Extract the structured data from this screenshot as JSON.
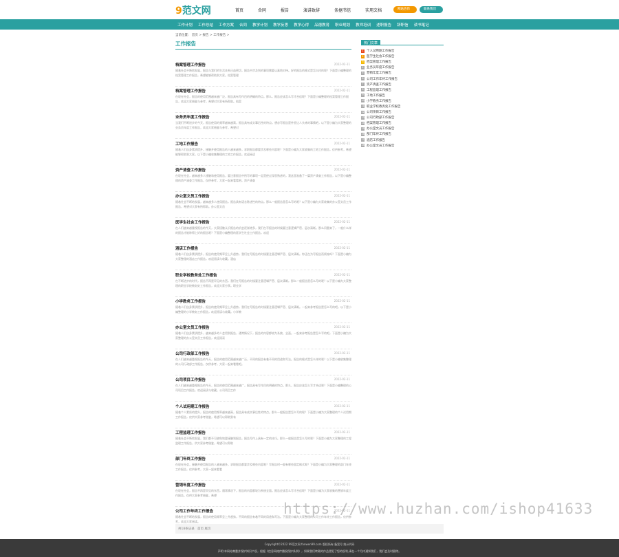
{
  "logo": {
    "nine": "9",
    "text": "范文网"
  },
  "topnav": [
    "首页",
    "合同",
    "报告",
    "演讲致辞",
    "条据书信",
    "实用文档"
  ],
  "header_buttons": {
    "login": "网站合作",
    "login2": "联系我们"
  },
  "categories": [
    "工作计划",
    "工作总结",
    "工作方案",
    "合同",
    "教学计划",
    "教学反思",
    "教学心得",
    "品德教育",
    "职业规划",
    "教师培训",
    "述职报告",
    "辞职信",
    "读书笔记"
  ],
  "breadcrumb": "当前位置： 首页 > 报告 > 工作报告 >",
  "main_title": "工作报告",
  "articles": [
    {
      "title": "档案管理工作报告",
      "date": "2022-02-11",
      "summary": "随着社会不断地发展，报告与我们的生活关系日益密切，报告中涉及到的事项需要认真地对待。好的报告的格式是怎么样的呢？下面是小编整理的档案管理工作报告，希望能够帮助到大家。档案管理"
    },
    {
      "title": "档案管理工作报告",
      "date": "2022-02-11",
      "summary": "在现在社会，报告的使用范围越来越广泛，报告具有写作目的明确的特点。那么，报告应该怎么写才合适呢？下面是小编整理的档案管理工作报告，欢迎大家借鉴与参考，希望对大家有所帮助。档案"
    },
    {
      "title": "业务员年度工作报告",
      "date": "2022-02-11",
      "summary": "当我们不断进步的今天，报告使用的频率越来越高，报告具有成文事后性的特点。想必写报告是件很让人头疼的事情吧，以下是小编为大家整理的业务员年度工作报告，欢迎大家借鉴与参考，希望对"
    },
    {
      "title": "工地工作报告",
      "date": "2022-02-11",
      "summary": "随着人们自身素质提升，接触并使用报告的人越来越多，求职报告都要涉及哪些内容呢？下面是小编为大家收集的工地工作报告，仅供参考，希望能够帮助到大家。以下是小编收集整理的工地工作报告，欢迎阅读"
    },
    {
      "title": "资产清查工作报告",
      "date": "2022-02-11",
      "summary": "在现在社会，越来越多人接触和使用报告，要注意报告中所写的事项一定是经过深思熟虑的，我这里准备了一篇资产清查工作报告，以下是小编整理的资产清查工作报告，仅供参考，大家一起来看看吧。资产清查"
    },
    {
      "title": "办公室文员工作报告",
      "date": "2022-02-11",
      "summary": "随着社会不断地发展，越来越多人使用报告，报告具有语言陈述性的特点。那么一般报告是怎么写的呢？以下是小编为大家收集的办公室文员工作报告，希望对大家有所帮助。办公室文员"
    },
    {
      "title": "医学生社会工作报告",
      "date": "2022-02-11",
      "summary": "在人们越来越重视报告的今天，大家接触认识报告的机会逐渐增多，我们在写报告的时候要注意逻辑严密、层次清晰。那么问题来了，一般什么样的报告才能称得上好的报告呢？下面是小编整理的医学生社会工作报告，欢迎"
    },
    {
      "title": "酒店工作报告",
      "date": "2022-02-11",
      "summary": "随着人们自身素质提升，报告的使用频率呈上升趋势，我们在写报告的时候要注意逻辑严密、层次清晰。你还在为写报告而烦恼吗？下面是小编为大家整理的酒店工作报告，欢迎阅读与收藏。酒店"
    },
    {
      "title": "职业学校教务处工作报告",
      "date": "2022-02-11",
      "summary": "在不断进步的时代，报告不再是罕见的东西，我们在写报告的时候要注意逻辑严密、层次清晰。那么一般报告是怎么写的呢？以下是小编为大家整理的职业学校教务处工作报告，欢迎大家分享。职业学"
    },
    {
      "title": "小学教务工作报告",
      "date": "2022-02-11",
      "summary": "随着人们自身素质提升，报告的使用频率呈上升趋势，我们在写报告的时候要注意逻辑严密、层次清晰。一起来参考报告是怎么写的吧，以下是小编整理的小学教务工作报告，欢迎阅读与收藏。小学教"
    },
    {
      "title": "办公室文员工作报告",
      "date": "2022-02-11",
      "summary": "随着人们自身素质提升，越来越多的人会用到报告，通常情况下，报告的内容都较为系统、全面。一起来参考报告是怎么写的吧，下面是小编为大家整理的办公室文员工作报告，欢迎阅读"
    },
    {
      "title": "公司行政部工作报告",
      "date": "2022-02-11",
      "summary": "在人们越来越重视报告的今天，报告的使用范围越来越广泛，不同的报告有着不同的用途和写法。报告的格式是怎么样的呢？以下是小编收集整理的公司行政部工作报告，仅供参考，大家一起来看看吧。"
    },
    {
      "title": "公司项目工作报告",
      "date": "2022-02-11",
      "summary": "在人们越来越重视报告的今天，报告的使用范围越来越广，报告具有写作目的明确的特点。那么，报告应该怎么写才合适呢？下面是小编整理的公司项目工作报告，欢迎阅读与收藏。公司项目工作"
    },
    {
      "title": "个人试用期工作报告",
      "date": "2022-02-11",
      "summary": "随着个人素质的提升，报告的使用频率越来越高，报告具有成文事后性的特点。那么一般报告是怎么写的呢？下面是小编为大家整理的个人试用期工作报告，仅供大家参考借鉴，希望可以帮助到有"
    },
    {
      "title": "工程监理工作报告",
      "date": "2022-02-11",
      "summary": "随着社会不断地发展，我们都不可避免地要接触到报告，报告写作上具有一定的技巧。那么一般报告是怎么写的呢？下面是小编为大家整理的工程监理工作报告，供大家参考借鉴，希望可以帮助"
    },
    {
      "title": "部门年终工作报告",
      "date": "2022-02-11",
      "summary": "在现在社会，接触并使用报告的人越来越多，求职报告都要涉及哪些内容呢？写报告时一般有哪些固定格式呢？下面是小编为大家整理的部门年终工作报告，仅供参考，大家一起来看看"
    },
    {
      "title": "营销年度工作报告",
      "date": "2022-02-11",
      "summary": "在现在社会，报告不再是罕见的东西，通常情况下，报告的内容都较为系统全面。报告应该怎么写才合适呢？下面是小编为大家收集的营销年度工作报告，仅供大家参考借鉴，希望"
    },
    {
      "title": "公司工作年终工作报告",
      "date": "2022-02-11",
      "summary": "随着社会不断地发展，报告的使用频率呈上升趋势，不同的报告有着不同的用途和写法。下面是小编为大家整理的公司工作年终工作报告，仅供参考，欢迎大家阅读。"
    }
  ],
  "pager": {
    "label": "共18条记录",
    "page": "首页 尾页"
  },
  "sidebar": {
    "title": "热门文章",
    "items": [
      "个人试用期工作报告",
      "医学生社会工作报告",
      "档案管理工作报告",
      "业务员年度工作报告",
      "营销年度工作报告",
      "公司工作年终工作报告",
      "资产清查工作报告",
      "工程监理工作报告",
      "工地工作报告",
      "小学教务工作报告",
      "职业学校教务处工作报告",
      "公司项目工作报告",
      "公司行政部工作报告",
      "档案管理工作报告",
      "办公室文员工作报告",
      "部门年终工作报告",
      "酒店工作报告",
      "办公室文员工作报告"
    ]
  },
  "watermark": "https://www.huzhan.com/ishop41633",
  "footer": {
    "line1": "Copyright©2022 99范文网 fanwen99.com 版权所有 备案号 统计代码",
    "line2": "声明:本网站尊重并保护知识产权，根据《信息网络传播权保护条例》，如果我们转载的作品侵犯了您的权利,请在一个月内通知我们，我们会及时删除。"
  }
}
